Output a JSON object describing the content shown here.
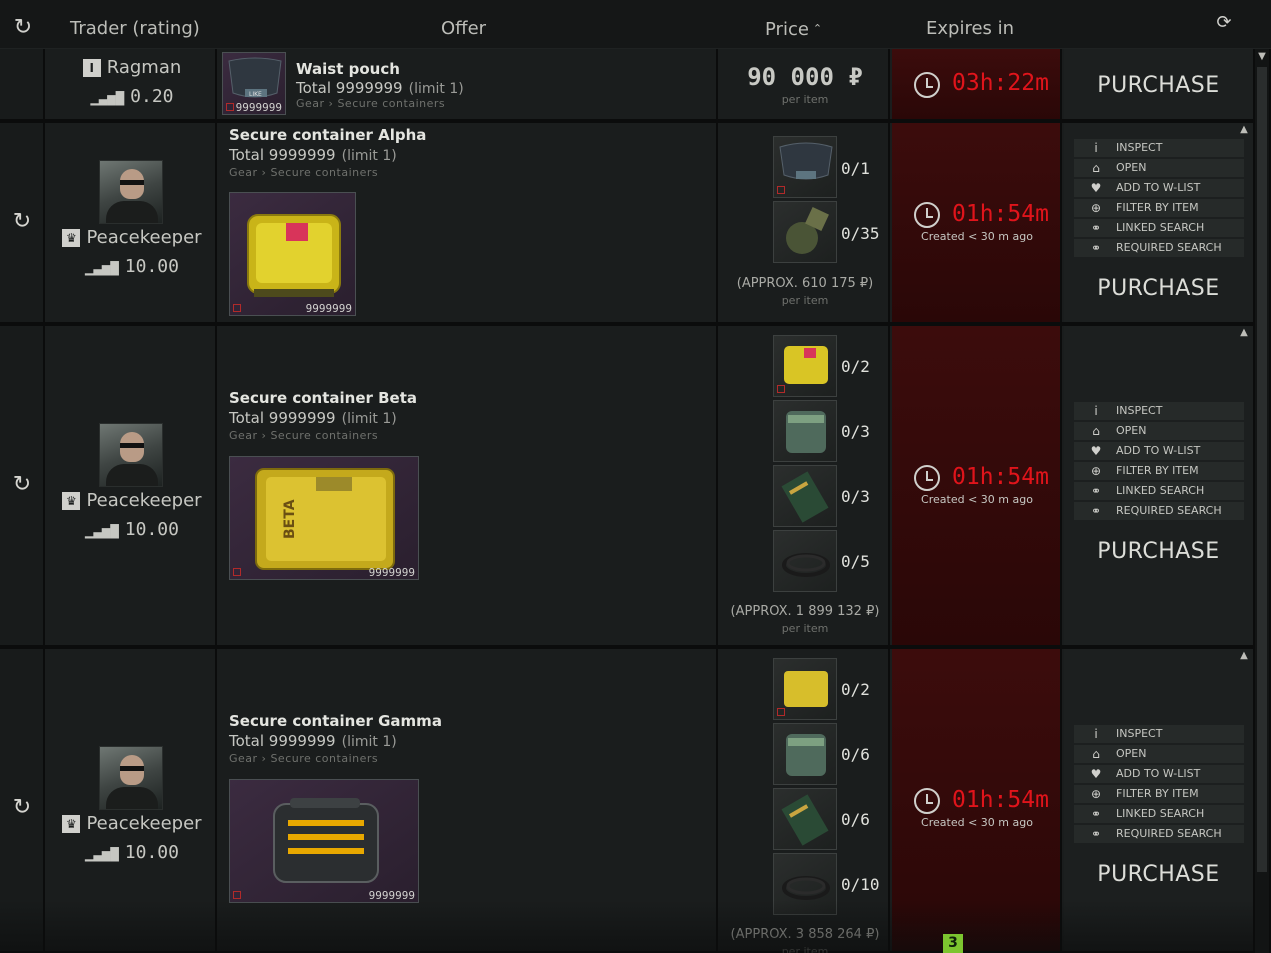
{
  "header": {
    "trader_col": "Trader (rating)",
    "offer_col": "Offer",
    "price_col": "Price",
    "expires_col": "Expires in",
    "sort_arrow": "⌃"
  },
  "icons": {
    "refresh": "⟲⟳",
    "reload": "⟳",
    "rating_bars": "▁▃▅▇",
    "clock": "clock-icon",
    "inspect": "i",
    "open": "⌂",
    "wishlist": "♥",
    "filter": "⊕",
    "linked": "⚭",
    "required": "⚭"
  },
  "rows": [
    {
      "trader_name": "Ragman",
      "trader_badge": "I",
      "rating": "0.20",
      "offer_title": "Waist pouch",
      "offer_total": "Total 9999999",
      "offer_limit": "(limit 1)",
      "offer_path": "Gear › Secure containers",
      "item_count": "9999999",
      "price": "90 000 ₽",
      "per_item": "per item",
      "time": "03h:22m",
      "purchase": "PURCHASE"
    },
    {
      "trader_name": "Peacekeeper",
      "trader_badge": "♛",
      "rating": "10.00",
      "offer_title": "Secure container Alpha",
      "offer_total": "Total 9999999",
      "offer_limit": "(limit 1)",
      "offer_path": "Gear › Secure containers",
      "item_count": "9999999",
      "requirements": [
        "0/1",
        "0/35"
      ],
      "approx": "(APPROX. 610 175 ₽)",
      "per_item": "per item",
      "time": "01h:54m",
      "created": "Created < 30 m ago",
      "purchase": "PURCHASE"
    },
    {
      "trader_name": "Peacekeeper",
      "trader_badge": "♛",
      "rating": "10.00",
      "offer_title": "Secure container Beta",
      "offer_total": "Total 9999999",
      "offer_limit": "(limit 1)",
      "offer_path": "Gear › Secure containers",
      "item_count": "9999999",
      "requirements": [
        "0/2",
        "0/3",
        "0/3",
        "0/5"
      ],
      "approx": "(APPROX. 1 899 132 ₽)",
      "per_item": "per item",
      "time": "01h:54m",
      "created": "Created < 30 m ago",
      "purchase": "PURCHASE"
    },
    {
      "trader_name": "Peacekeeper",
      "trader_badge": "♛",
      "rating": "10.00",
      "offer_title": "Secure container Gamma",
      "offer_total": "Total 9999999",
      "offer_limit": "(limit 1)",
      "offer_path": "Gear › Secure containers",
      "item_count": "9999999",
      "requirements": [
        "0/2",
        "0/6",
        "0/6",
        "0/10"
      ],
      "approx": "(APPROX. 3 858 264 ₽)",
      "per_item": "per item",
      "time": "01h:54m",
      "created": "Created < 30 m ago",
      "purchase": "PURCHASE"
    }
  ],
  "menu": {
    "inspect": "INSPECT",
    "open": "OPEN",
    "wishlist": "ADD TO W-LIST",
    "filter": "FILTER BY ITEM",
    "linked": "LINKED SEARCH",
    "required": "REQUIRED SEARCH"
  },
  "page_badge": "3"
}
